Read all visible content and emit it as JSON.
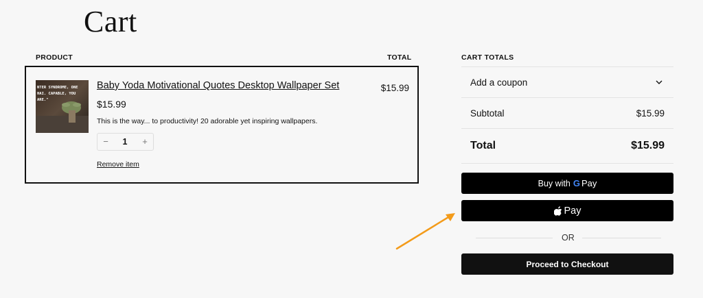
{
  "page": {
    "title": "Cart"
  },
  "cart_table": {
    "product_header": "PRODUCT",
    "total_header": "TOTAL"
  },
  "item": {
    "thumb_text": "NTER SYNDROME, ONE HAI. CAPABLE, YOU ARE.\"",
    "name": "Baby Yoda Motivational Quotes Desktop Wallpaper Set",
    "price": "$15.99",
    "description": "This is the way... to productivity! 20 adorable yet inspiring wallpapers.",
    "quantity": "1",
    "minus_icon": "−",
    "plus_icon": "+",
    "remove_label": "Remove item",
    "line_total": "$15.99"
  },
  "totals": {
    "header": "CART TOTALS",
    "coupon_label": "Add a coupon",
    "subtotal_label": "Subtotal",
    "subtotal_value": "$15.99",
    "total_label": "Total",
    "total_value": "$15.99"
  },
  "payments": {
    "gpay_prefix": "Buy with",
    "gpay_suffix": "Pay",
    "applepay_label": "Pay",
    "or_label": "OR",
    "checkout_label": "Proceed to Checkout"
  },
  "colors": {
    "accent": "#111111",
    "annotation_arrow": "#f39b1a",
    "button_bg": "#000000"
  }
}
